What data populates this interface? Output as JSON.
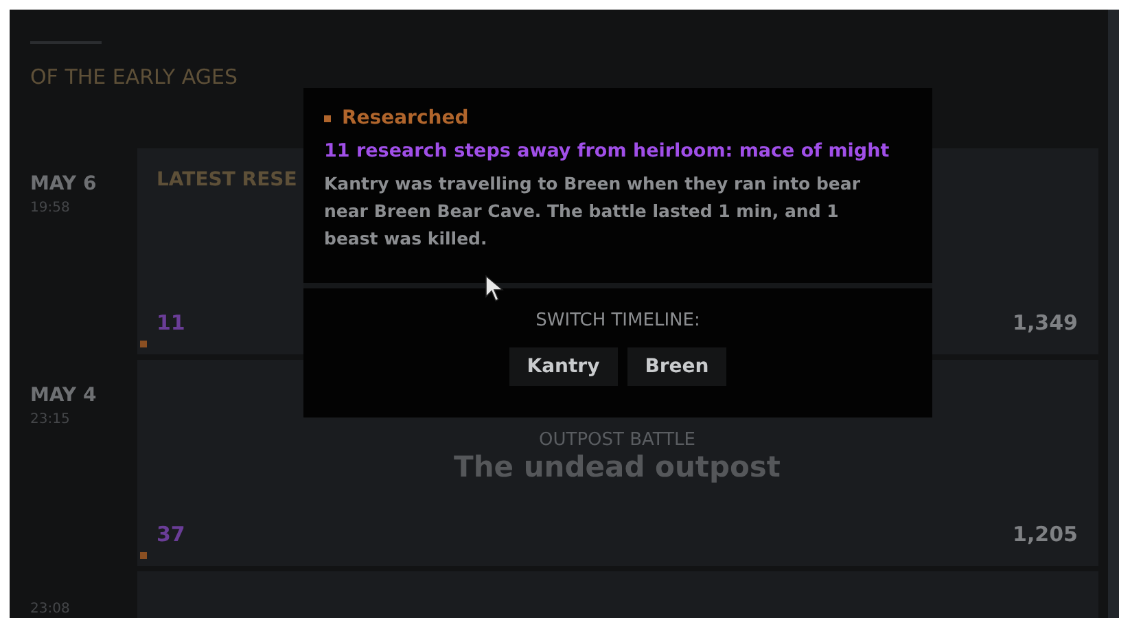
{
  "header": {
    "subtitle": "OF THE EARLY AGES"
  },
  "timeline": [
    {
      "date": "MAY 6",
      "time": "19:58",
      "card": {
        "heading": "LATEST RESE",
        "count": "11",
        "score": "1,349"
      }
    },
    {
      "date": "MAY 4",
      "time": "23:15",
      "card": {
        "category": "OUTPOST BATTLE",
        "title": "The undead outpost",
        "count": "37",
        "score": "1,205"
      }
    },
    {
      "time": "23:08"
    }
  ],
  "popup": {
    "tag": "Researched",
    "headline": "11 research steps away from heirloom: mace of might",
    "body": "Kantry was travelling to Breen when they ran into bear near Breen Bear Cave. The battle lasted 1 min, and 1 beast was killed.",
    "switch_label": "SWITCH TIMELINE:",
    "buttons": [
      "Kantry",
      "Breen"
    ]
  }
}
